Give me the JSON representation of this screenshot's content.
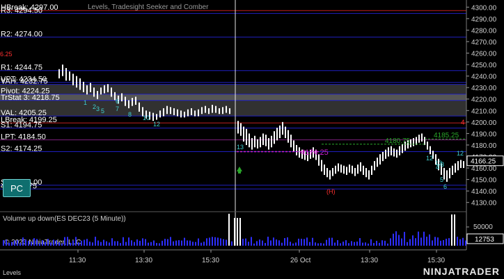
{
  "chart_title": "Levels, Tradesight Seeker and Comber",
  "pc_button": "PC",
  "volume_title": "Volume up down(ES DEC23 (5 Minute))",
  "copyright": "© 2023 NinjaTrader, LLC",
  "bottom_tab": "Levels",
  "logo": "NINJATRADER",
  "colors": {
    "background": "#000000",
    "up_bar": "#ffffff",
    "volume": "#2e2eff",
    "volume_spike": "#ffffff",
    "level_blue": "#1f1fbf",
    "level_red": "#c21f1f",
    "level_purple": "#7a1f7a",
    "va_band": "#5a5a5a",
    "current_price_tag": "#ffffff"
  },
  "price_axis": {
    "min": 4125,
    "max": 4305,
    "ticks": [
      "4300.00",
      "4290.00",
      "4280.00",
      "4270.00",
      "4260.00",
      "4250.00",
      "4240.00",
      "4230.00",
      "4220.00",
      "4210.00",
      "4200.00",
      "4190.00",
      "4180.00",
      "4170.00",
      "4160.00",
      "4150.00",
      "4140.00",
      "4130.00"
    ],
    "current_price": "4166.25",
    "volume_tick": "50000",
    "volume_current": "12753"
  },
  "time_axis": [
    "11:30",
    "13:30",
    "15:30",
    "26 Oct",
    "13:30",
    "15:30"
  ],
  "levels": [
    {
      "label": "HBreak: 4297.00",
      "price": 4297.0,
      "color": "red"
    },
    {
      "label": "R3: 4294.50",
      "price": 4294.5,
      "color": "blue"
    },
    {
      "label": "R2: 4274.00",
      "price": 4274.0,
      "color": "blue"
    },
    {
      "label": "R1: 4244.75",
      "price": 4244.75,
      "color": "blue"
    },
    {
      "label": "VPT: 4234.50",
      "price": 4234.5,
      "color": "blue"
    },
    {
      "label": "VAH: 4232.75",
      "price": 4232.75,
      "color": "blue"
    },
    {
      "label": "Pivot: 4224.25",
      "price": 4224.25,
      "color": "blue"
    },
    {
      "label": "TrStat 3: 4218.75",
      "price": 4218.75,
      "color": "blue"
    },
    {
      "label": "VAL: 4205.25",
      "price": 4205.25,
      "color": "blue"
    },
    {
      "label": "LBreak: 4199.25",
      "price": 4199.25,
      "color": "red"
    },
    {
      "label": "S1: 4194.75",
      "price": 4194.75,
      "color": "blue"
    },
    {
      "label": "LPT: 4184.50",
      "price": 4184.5,
      "color": "purple"
    },
    {
      "label": "S2: 4174.25",
      "price": 4174.25,
      "color": "blue"
    },
    {
      "label": "S3: 4145.00",
      "price": 4145.0,
      "color": "blue"
    },
    {
      "label": "4: 4141.75",
      "price": 4141.75,
      "color": "blue"
    }
  ],
  "annotations": {
    "red_left": "6.25",
    "green_4185": "4185.25",
    "green_4180": "4180.75",
    "magenta_4174": "4174.25",
    "red_h": "(H)",
    "seeker_numbers": [
      "1",
      "2",
      "3",
      "5",
      "6",
      "7",
      "8",
      "10",
      "12",
      "13",
      "12",
      "13",
      "12",
      "3",
      "4",
      "5",
      "6"
    ]
  }
}
